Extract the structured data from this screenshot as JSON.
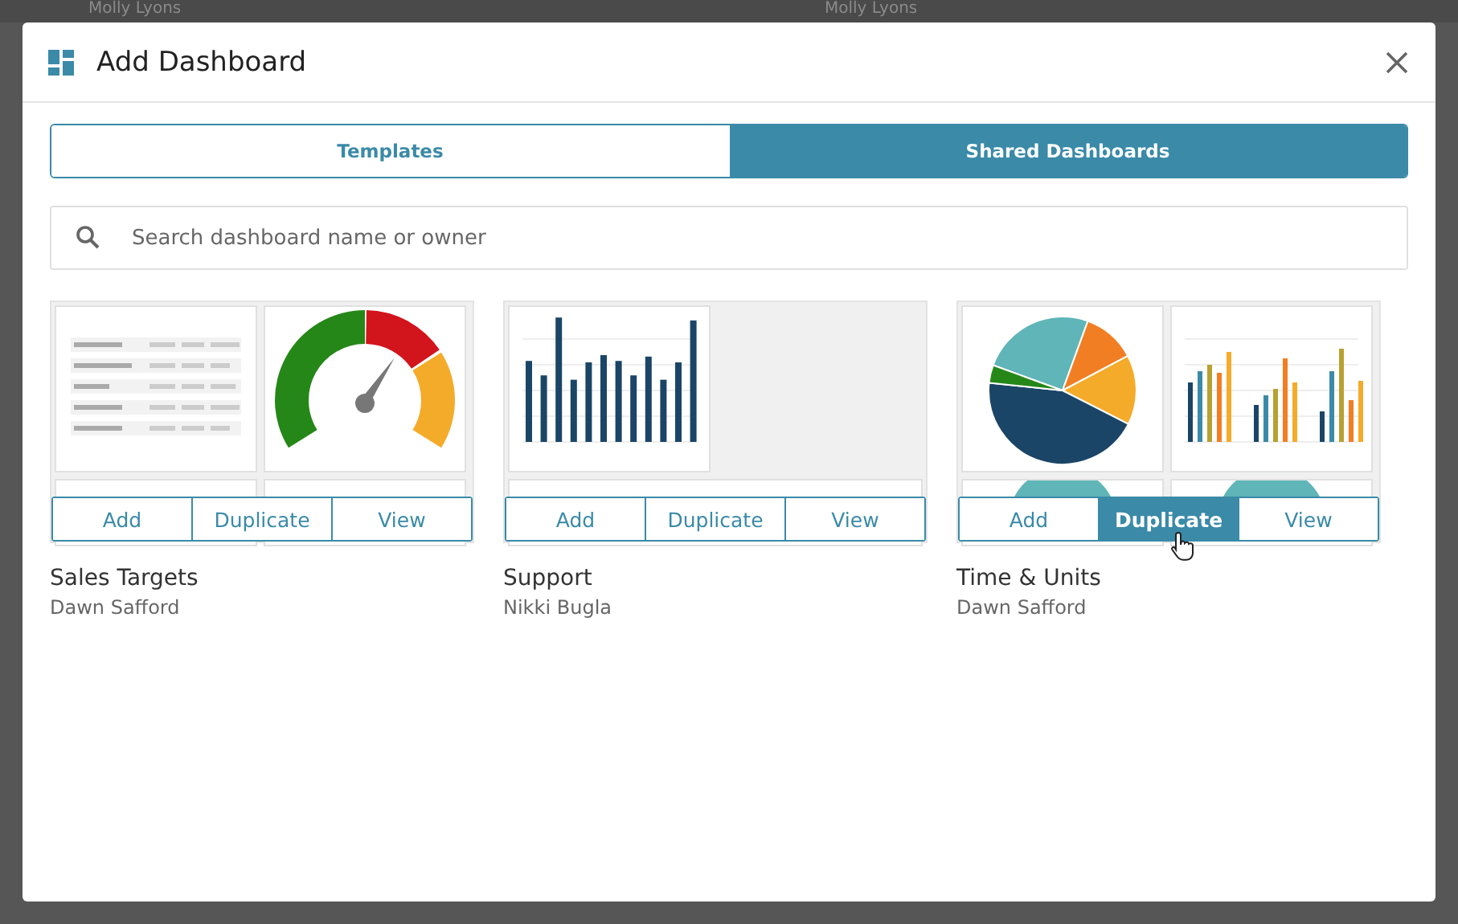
{
  "backdrop": {
    "texts": [
      "Molly Lyons",
      "Molly Lyons"
    ]
  },
  "dialog": {
    "title": "Add Dashboard"
  },
  "tabs": [
    {
      "label": "Templates",
      "selected": false
    },
    {
      "label": "Shared Dashboards",
      "selected": true
    }
  ],
  "search": {
    "placeholder": "Search dashboard name or owner"
  },
  "dashboards": [
    {
      "name": "Sales Targets",
      "owner": "Dawn Safford",
      "tiles": [
        {
          "kind": "table"
        },
        {
          "kind": "gauge"
        }
      ],
      "lower_tiles": [
        {
          "kind": "blank"
        },
        {
          "kind": "blank"
        }
      ],
      "buttons": [
        {
          "label": "Add",
          "hovered": false
        },
        {
          "label": "Duplicate",
          "hovered": false
        },
        {
          "label": "View",
          "hovered": false
        }
      ]
    },
    {
      "name": "Support",
      "owner": "Nikki Bugla",
      "tiles": [
        {
          "kind": "bars"
        }
      ],
      "lower_tiles": [
        {
          "kind": "wide"
        }
      ],
      "buttons": [
        {
          "label": "Add",
          "hovered": false
        },
        {
          "label": "Duplicate",
          "hovered": false
        },
        {
          "label": "View",
          "hovered": false
        }
      ]
    },
    {
      "name": "Time & Units",
      "owner": "Dawn Safford",
      "tiles": [
        {
          "kind": "pie"
        },
        {
          "kind": "grouped-bars"
        }
      ],
      "lower_tiles": [
        {
          "kind": "donut"
        },
        {
          "kind": "donut"
        }
      ],
      "buttons": [
        {
          "label": "Add",
          "hovered": false
        },
        {
          "label": "Duplicate",
          "hovered": true
        },
        {
          "label": "View",
          "hovered": false
        }
      ]
    }
  ]
}
